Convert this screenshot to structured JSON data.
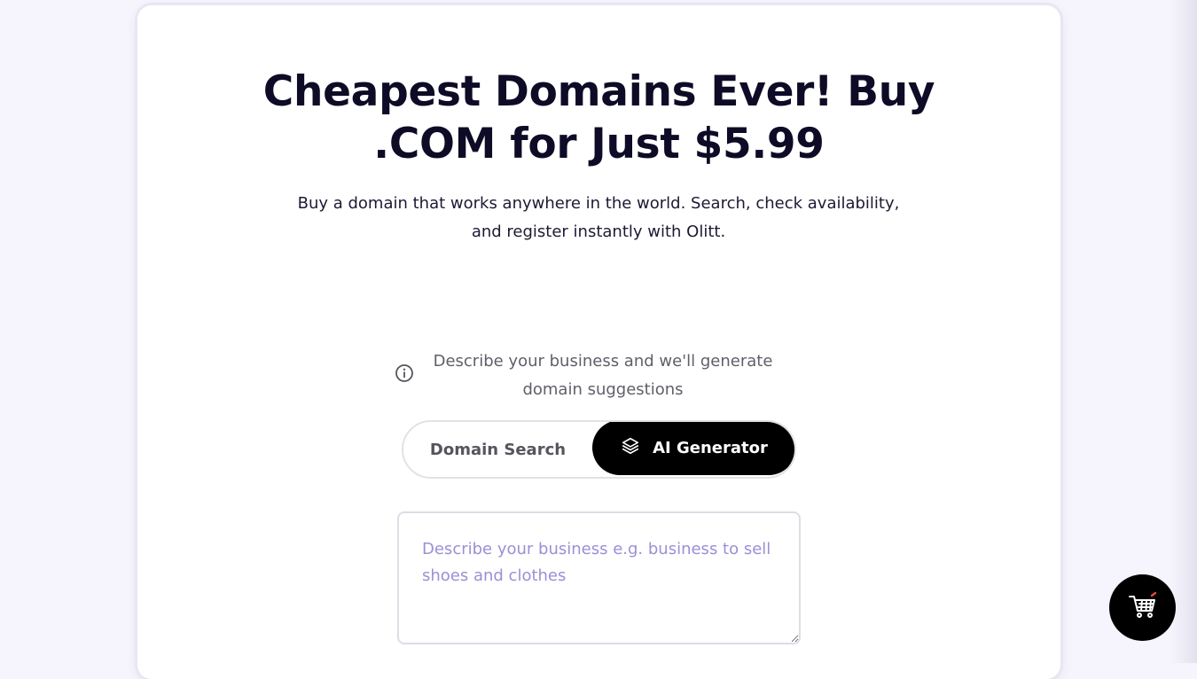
{
  "hero": {
    "title_line1": "Cheapest Domains Ever! Buy",
    "title_line2": ".COM for Just $5.99",
    "subtitle_line1": "Buy a domain that works anywhere in the world. Search, check availability,",
    "subtitle_line2": "and register instantly with Olitt."
  },
  "info": {
    "icon": "info-circle-icon",
    "text_line1": "Describe your business and we'll generate",
    "text_line2": "domain suggestions"
  },
  "tabs": {
    "search_label": "Domain Search",
    "ai_label": "AI Generator",
    "ai_icon": "layers-icon",
    "active": "AI Generator"
  },
  "ai_input": {
    "placeholder": "Describe your business e.g. business to sell shoes and clothes",
    "value": ""
  },
  "cart": {
    "icon": "shopping-cart-icon"
  },
  "colors": {
    "background": "#f6f4fd",
    "title": "#0d0b26",
    "active_tab": "#000000",
    "placeholder": "#9b8fd6",
    "cart_accent": "#e2483d"
  }
}
